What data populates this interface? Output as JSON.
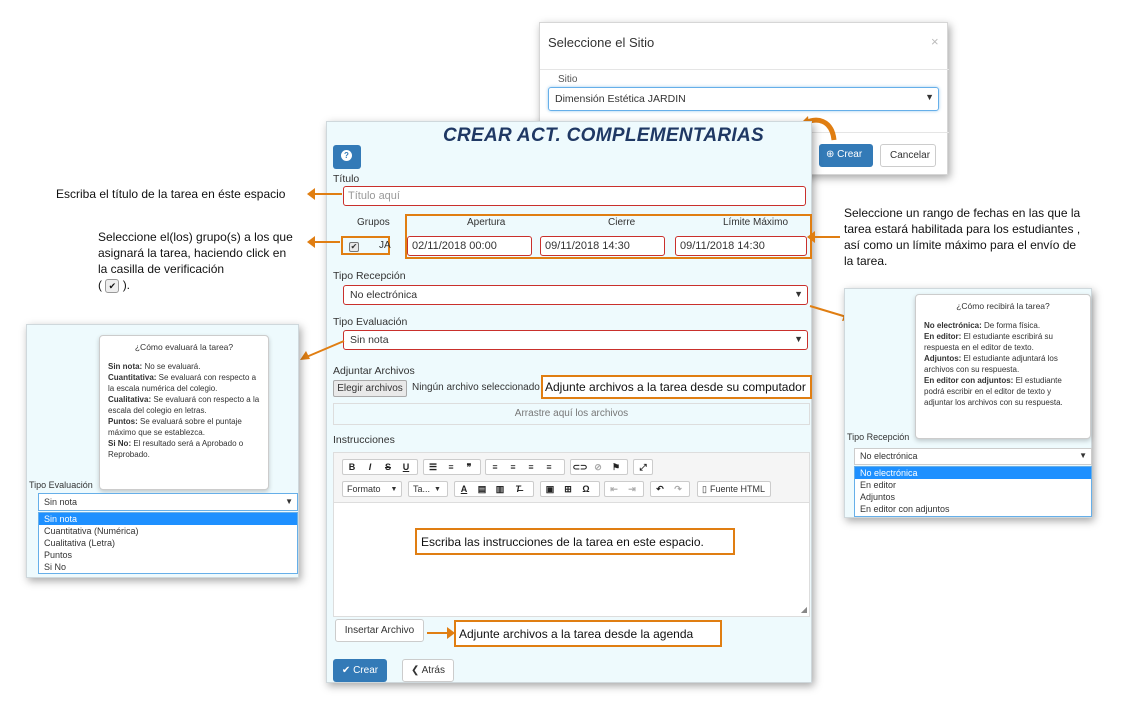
{
  "site_modal": {
    "title": "Seleccione el Sitio",
    "close": "×",
    "site_label": "Sitio",
    "site_value": "Dimensión Estética JARDIN",
    "crear_label": "Crear",
    "cancel_label": "Cancelar"
  },
  "form": {
    "title": "CREAR ACT. COMPLEMENTARIAS",
    "help_icon": "?",
    "titulo_label": "Título",
    "titulo_placeholder": "Título aquí",
    "grupos_label": "Grupos",
    "apertura_label": "Apertura",
    "cierre_label": "Cierre",
    "limite_label": "Límite Máximo",
    "group_name": "JA",
    "apertura_value": "02/11/2018 00:00",
    "cierre_value": "09/11/2018 14:30",
    "limite_value": "09/11/2018 14:30",
    "recepcion_label": "Tipo Recepción",
    "recepcion_value": "No electrónica",
    "evaluacion_label": "Tipo Evaluación",
    "evaluacion_value": "Sin nota",
    "adjuntar_label": "Adjuntar Archivos",
    "file_button": "Elegir archivos",
    "file_none": "Ningún archivo seleccionado",
    "dropzone": "Arrastre aquí los archivos",
    "instrucciones_label": "Instrucciones",
    "toolbar": {
      "bold": "B",
      "italic": "I",
      "strike": "S",
      "underline": "U",
      "formato": "Formato",
      "tamano": "Ta...",
      "font_color": "A",
      "omega": "Ω",
      "source": "Fuente HTML"
    },
    "insert_button": "Insertar Archivo",
    "crear_button": "Crear",
    "atras_button": "Atrás"
  },
  "callouts": {
    "titulo": "Escriba el título de la tarea en éste espacio",
    "grupos": [
      "Seleccione el(los) grupo(s) a los que",
      "asignará la tarea, haciendo click en",
      "la casilla de verificación",
      "(",
      ")."
    ],
    "fechas": [
      "Seleccione un rango de fechas en las que la",
      "tarea estará habilitada para los estudiantes ,",
      "así como un límite máximo para el envío de",
      "la tarea."
    ],
    "adjunte_pc": "Adjunte archivos a la tarea desde su computador",
    "instrucciones": "Escriba las instrucciones de la tarea en este espacio.",
    "adjunte_agenda": "Adjunte archivos a la tarea desde la agenda"
  },
  "left_panel": {
    "tooltip_title": "¿Cómo evaluará la tarea?",
    "tooltip_items": [
      {
        "term": "Sin nota:",
        "desc": " No se evaluará."
      },
      {
        "term": "Cuantitativa:",
        "desc": " Se evaluará con respecto a la escala numérica del colegio."
      },
      {
        "term": "Cualitativa:",
        "desc": " Se evaluará con respecto a la escala del colegio en letras."
      },
      {
        "term": "Puntos:",
        "desc": " Se evaluará sobre el puntaje máximo que se establezca."
      },
      {
        "term": "Si No:",
        "desc": " El resultado será a Aprobado o Reprobado."
      }
    ],
    "field_label": "Tipo Evaluación",
    "select_value": "Sin nota",
    "options": [
      "Sin nota",
      "Cuantitativa (Numérica)",
      "Cualitativa (Letra)",
      "Puntos",
      "Si No"
    ]
  },
  "right_panel": {
    "tooltip_title": "¿Cómo recibirá la tarea?",
    "tooltip_items": [
      {
        "term": "No electrónica:",
        "desc": " De forma física."
      },
      {
        "term": "En editor:",
        "desc": " El estudiante escribirá su respuesta en el editor de texto."
      },
      {
        "term": "Adjuntos:",
        "desc": " El estudiante adjuntará los archivos con su respuesta."
      },
      {
        "term": "En editor con adjuntos:",
        "desc": " El estudiante podrá escribir en el editor de texto y adjuntar los archivos con su respuesta."
      }
    ],
    "field_label": "Tipo Recepción",
    "select_value": "No electrónica",
    "options": [
      "No electrónica",
      "En editor",
      "Adjuntos",
      "En editor con adjuntos"
    ]
  },
  "colors": {
    "accent": "#e07e12",
    "primary": "#337ab7",
    "error_border": "#c9302c",
    "panel_bg": "#eefafd"
  }
}
